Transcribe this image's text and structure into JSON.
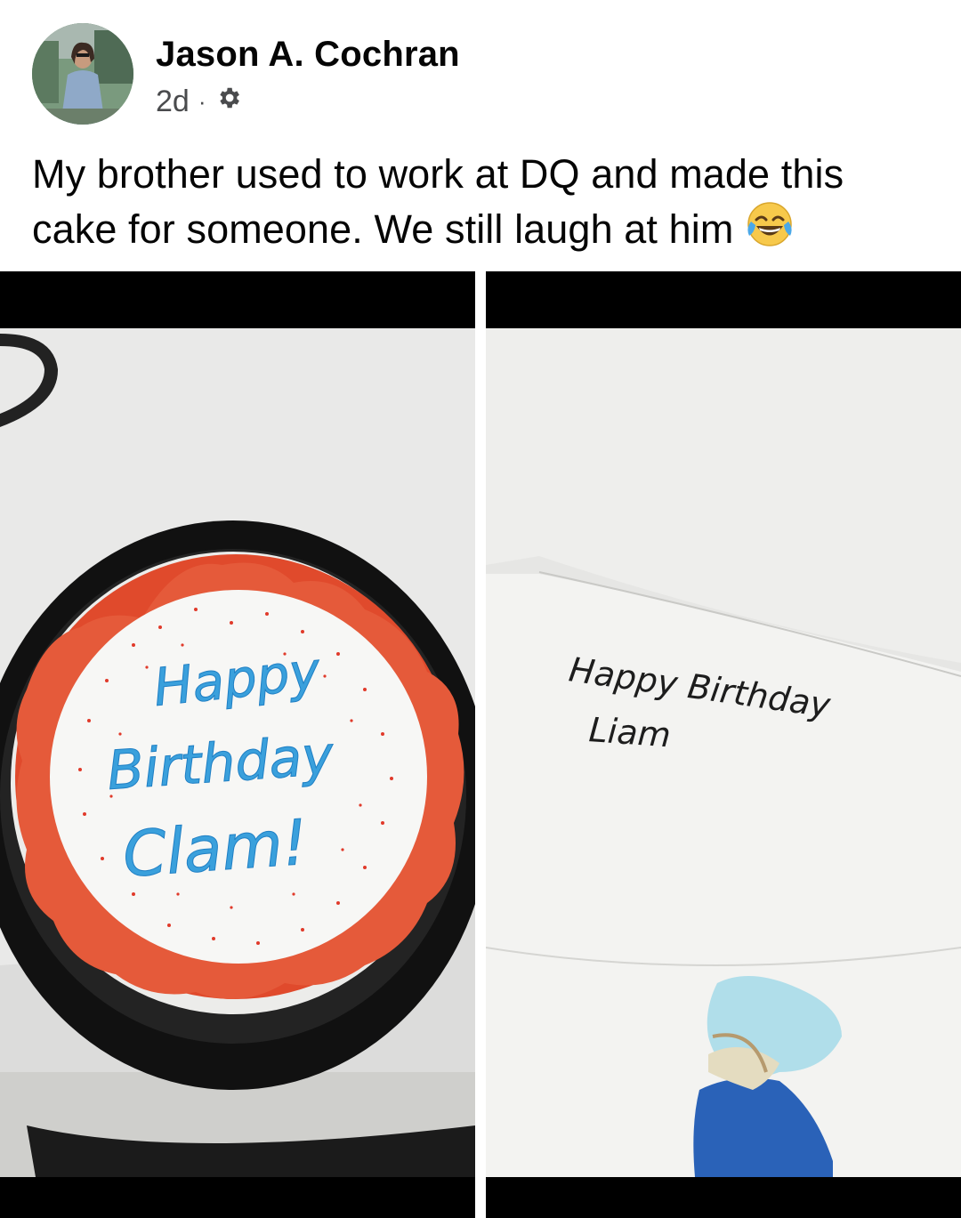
{
  "post": {
    "author": "Jason A. Cochran",
    "time": "2d",
    "separator": "·",
    "privacy_icon": "gear-icon",
    "text": "My brother used to work at DQ and made this cake for someone. We still laugh at him",
    "emoji": "face-with-tears-of-joy-icon"
  },
  "photos": {
    "left": {
      "cake_line1": "Happy",
      "cake_line2": "Birthday",
      "cake_line3": "Clam!"
    },
    "right": {
      "note_line1": "Happy Birthday",
      "note_line2": "Liam"
    }
  }
}
